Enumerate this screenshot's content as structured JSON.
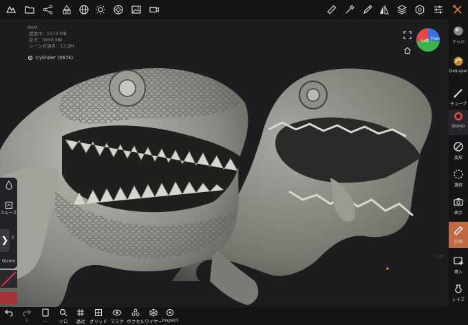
{
  "stats": {
    "ram": "RAM",
    "used": "使用中：2373 MB",
    "free": "空き：5856 MB",
    "vertices": "シーンの頂点：13.2M"
  },
  "mesh": {
    "name": "Cylinder (567k)"
  },
  "gizmo_cube": {
    "left_label": "Left",
    "front_label": "Fron"
  },
  "right_tools": [
    {
      "label": "ナッジ",
      "icon": "nudge-icon"
    },
    {
      "label": "DelLayer",
      "icon": "del-layer-icon"
    },
    {
      "label": "チューブ",
      "icon": "tube-icon"
    },
    {
      "label": "Gizmo",
      "icon": "gizmo-icon"
    },
    {
      "label": "変形",
      "icon": "transform-icon"
    },
    {
      "label": "選択",
      "icon": "select-icon"
    },
    {
      "label": "表示",
      "icon": "camera-icon"
    },
    {
      "label": "計測",
      "icon": "ruler-icon",
      "active": true
    },
    {
      "label": "挿入",
      "icon": "insert-icon"
    },
    {
      "label": "レイズ",
      "icon": "raise-icon"
    }
  ],
  "bottom_tools": [
    {
      "label": "",
      "icon": "undo-icon"
    },
    {
      "label": "0",
      "icon": "redo-icon"
    },
    {
      "label": "...",
      "icon": "layer-icon"
    },
    {
      "label": "ソロ",
      "icon": "search-icon"
    },
    {
      "label": "透过",
      "icon": "grid-transparency-icon"
    },
    {
      "label": "グリッド",
      "icon": "grid-icon"
    },
    {
      "label": "マスク",
      "icon": "eye-icon"
    },
    {
      "label": "ボクセル",
      "icon": "voxel-icon"
    },
    {
      "label": "ワイヤー",
      "icon": "wire-icon"
    },
    {
      "label": "Inspect",
      "icon": "inspect-icon"
    }
  ],
  "left_float": [
    {
      "label": "",
      "icon": "drop-icon"
    },
    {
      "label": "スムーズ",
      "icon": "smooth-icon"
    },
    {
      "label": "ク",
      "icon": "clay-icon"
    },
    {
      "label": "Gizmo",
      "icon": "gizmo-icon"
    }
  ],
  "version": "1.87",
  "colors": {
    "accent": "#c06a43",
    "cube_red": "#e64646",
    "cube_blue": "#3a6fe6",
    "cube_green": "#3cb44a"
  }
}
